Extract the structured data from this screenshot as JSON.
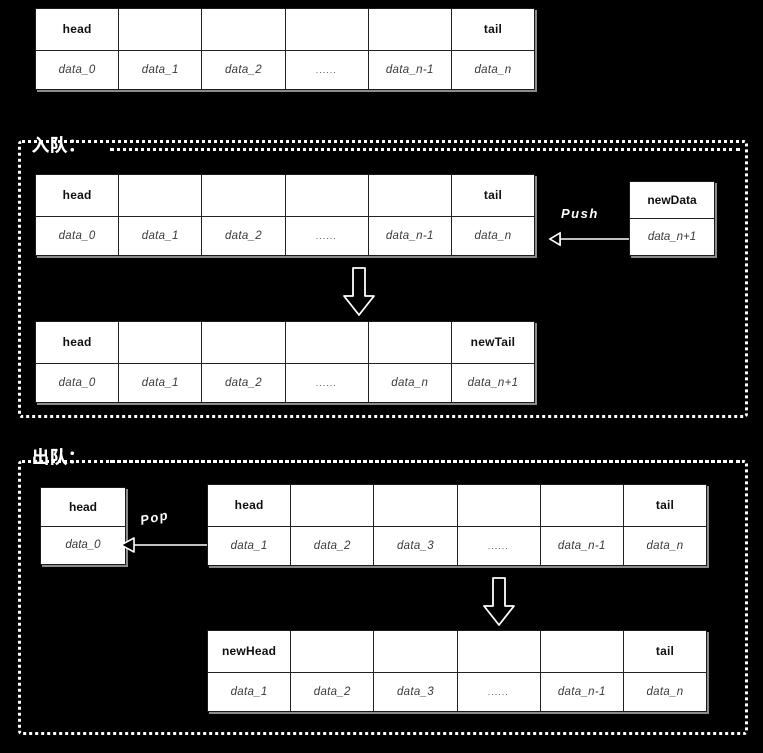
{
  "diagram": {
    "title": "Queue (enqueue / dequeue) structure diagram",
    "colors": {
      "background": "#000000",
      "box": "#ffffff",
      "ink": "#1a1a1a",
      "label": "#ffffff"
    }
  },
  "initial_queue": {
    "name": "initial-queue-table",
    "pointers": [
      "head",
      "",
      "",
      "",
      "",
      "tail"
    ],
    "values": [
      "data_0",
      "data_1",
      "data_2",
      "......",
      "data_n-1",
      "data_n"
    ]
  },
  "enqueue_section": {
    "label": "入队：",
    "before": {
      "name": "enqueue-before-table",
      "pointers": [
        "head",
        "",
        "",
        "",
        "",
        "tail"
      ],
      "values": [
        "data_0",
        "data_1",
        "data_2",
        "......",
        "data_n-1",
        "data_n"
      ]
    },
    "push": {
      "label": "Push",
      "node": {
        "pointer": "newData",
        "value": "data_n+1"
      }
    },
    "after": {
      "name": "enqueue-after-table",
      "pointers": [
        "head",
        "",
        "",
        "",
        "",
        "newTail"
      ],
      "values": [
        "data_0",
        "data_1",
        "data_2",
        "......",
        "data_n",
        "data_n+1"
      ]
    }
  },
  "dequeue_section": {
    "label": "出队：",
    "popped": {
      "pointer": "head",
      "value": "data_0"
    },
    "pop": {
      "label": "Pop"
    },
    "before": {
      "name": "dequeue-before-table",
      "pointers": [
        "head",
        "",
        "",
        "",
        "",
        "tail"
      ],
      "values": [
        "data_1",
        "data_2",
        "data_3",
        "......",
        "data_n-1",
        "data_n"
      ]
    },
    "after": {
      "name": "dequeue-after-table",
      "pointers": [
        "newHead",
        "",
        "",
        "",
        "",
        "tail"
      ],
      "values": [
        "data_1",
        "data_2",
        "data_3",
        "......",
        "data_n-1",
        "data_n"
      ]
    }
  },
  "icons": {
    "down_arrow": "down-arrow-icon",
    "left_arrow": "left-arrow-icon"
  }
}
